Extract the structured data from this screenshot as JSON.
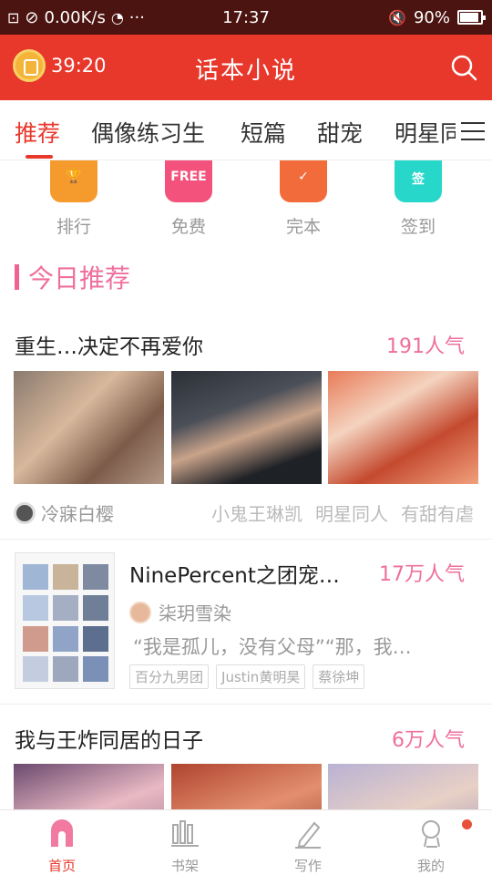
{
  "status_bar": {
    "left_icons": [
      "hd-icon",
      "no-sim-icon"
    ],
    "network_speed": "0.00K/s",
    "time": "17:37",
    "battery": "90%",
    "battery_level": 0.9
  },
  "header": {
    "timer": "39:20",
    "title": "话本小说"
  },
  "tabs": [
    {
      "label": "推荐",
      "active": true
    },
    {
      "label": "偶像练习生"
    },
    {
      "label": "短篇"
    },
    {
      "label": "甜宠"
    },
    {
      "label": "明星同"
    }
  ],
  "quick_links": [
    {
      "label": "排行",
      "icon": "trophy-icon",
      "glyph": "🏆"
    },
    {
      "label": "免费",
      "icon": "free-icon",
      "glyph": "FREE"
    },
    {
      "label": "完本",
      "icon": "complete-icon",
      "glyph": "✓"
    },
    {
      "label": "签到",
      "icon": "checkin-icon",
      "glyph": "签"
    }
  ],
  "section": {
    "title": "今日推荐"
  },
  "books": [
    {
      "title": "重生…决定不再爱你",
      "popularity": "191人气",
      "author": "冷寐白樱",
      "tags": [
        "小鬼王琳凯",
        "明星同人",
        "有甜有虐"
      ]
    },
    {
      "title": "NinePercent之团宠…",
      "popularity": "17万人气",
      "author": "柒玥雪染",
      "description": "“我是孤儿，没有父母”“那，我…",
      "tags": [
        "百分九男团",
        "Justin黄明昊",
        "蔡徐坤"
      ]
    },
    {
      "title": "我与王炸同居的日子",
      "popularity": "6万人气"
    }
  ],
  "bottom_nav": [
    {
      "label": "首页",
      "icon": "home-icon",
      "active": true
    },
    {
      "label": "书架",
      "icon": "bookshelf-icon"
    },
    {
      "label": "写作",
      "icon": "write-icon"
    },
    {
      "label": "我的",
      "icon": "profile-icon",
      "badge": true
    }
  ],
  "colors": {
    "brand": "#e8372b",
    "accent_pink": "#ef6f9d",
    "status_bar": "#4b1410"
  }
}
